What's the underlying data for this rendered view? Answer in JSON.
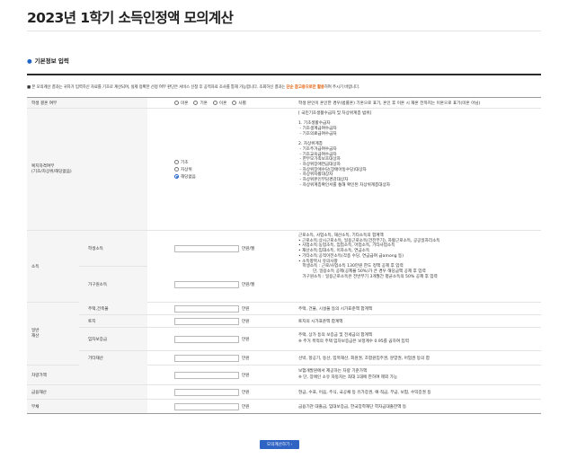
{
  "page": {
    "title": "2023년 1학기 소득인정액 모의계산"
  },
  "section": {
    "title": "기본정보 입력"
  },
  "notice": {
    "prefix": "■ 본 모의계산 결과는 귀하가 입력하신 자료를 기초로 계산되며, 실제 정확한 선정 여부 판단은 서비스 신청 후 공적자료 조사를 통해 가능합니다. 조회하신 결과는 ",
    "highlight": "단순 참고용으로만 활용",
    "suffix": "하여 주시기 바랍니다."
  },
  "marriage": {
    "label": "학생 결혼 여부",
    "options": [
      "미혼",
      "기혼",
      "이혼",
      "사별"
    ],
    "selected": "",
    "desc": "학생 본인이 혼인한 경우(법률혼) 기혼으로 표기, 혼인 후 이혼 시 재혼 전까지는 이혼으로 표기(미혼 아님)"
  },
  "welfare": {
    "label1": "복지자격여부",
    "label2": "(기초/차상위/해당없음)",
    "options": [
      "기초",
      "차상위",
      "해당없음"
    ],
    "selected": "해당없음",
    "desc": [
      "[ 국민기초생활수급자 및 차상위계층 범위]",
      "",
      "1. 기초생활수급자",
      " - 기초생계급여수급자",
      " - 기초의료급여수급자",
      "",
      "2. 차상위계층",
      " - 기초주거급여수급자",
      " - 기초교육급여수급자",
      " - 한부모가족보호대상자",
      " - 차상위장애연금대상자",
      " - 차상위장애수당(장애아동수당)대상자",
      " - 차상위자활대상자",
      " - 차상위본인부담경감대상자",
      " - 차상위계층확인서를 통해 확인된 차상위계층대상자"
    ]
  },
  "income": {
    "group_label": "소득",
    "student_label": "학생소득",
    "family_label": "가구원소득",
    "unit": "만원/월",
    "desc": [
      "근로소득, 사업소득, 재산소득, 기타소득의 합계액",
      "• 근로소득:상시근로소득, 일용근로소득(건전부기), 자활근로소득, 공공일자리소득",
      "• 사업소득:농업소득, 임업소득, 어업소득, 기타사업소득",
      "• 재산소득:임대소득, 이자소득, 연금소득",
      "• 기타소득:공적이전소득(각종 수당, 연금급여 급among 등)",
      "• 소득항목시 유의사항",
      "   학생소득 : 근로/사업소득 130만원 한도 정액 공제 후 입력",
      "           단, 일용소득 공제(공제율 50%)가 큰 경우 해당금액 공제 후 입력",
      "   가구원소득 : 일용근로소득은 전반부기 3개월간 평균소득의 50% 공제 후 입력"
    ]
  },
  "property": {
    "group_label1": "일반",
    "group_label2": "재산",
    "unit": "만원",
    "items": [
      {
        "label": "주택,건축물",
        "desc": "주택, 건물, 시설물 등의 시가표준액 합계액"
      },
      {
        "label": "토지",
        "desc": "토지의 시가표준액 합계액"
      },
      {
        "label": "임차보증금",
        "desc1": "주택, 상가 등의 보증금 및 전세금의 합계액",
        "desc2": "※ 주거 목적의 주택 임차보증금은 보정계수 0.95를 곱하여 입력"
      },
      {
        "label": "기타재산",
        "desc": "선박, 항공기, 동산, 입목재산, 회원권, 조합원입주권, 분양권, 어업권 등의 합"
      }
    ]
  },
  "vehicle": {
    "label": "차량가액",
    "unit": "만원",
    "desc1": "보험개발원에서 제공하는 차량 기준가액",
    "desc2": "※ 단, 장애인 소유 자동차는 최대 1대에 한하여 제외 가능"
  },
  "finance": {
    "label": "금융재산",
    "unit": "만원",
    "desc": "현금, 수표, 어음, 주식, 국공채 등 유가증권, 예·적금, 부금, 보험, 수익증권 등"
  },
  "debt": {
    "label": "부채",
    "unit": "만원",
    "desc": "금융기관 대출금, 임대보증금, 한국장학재단 학자금대출잔액 등"
  },
  "button": {
    "label": "모의계산하기 ›"
  }
}
